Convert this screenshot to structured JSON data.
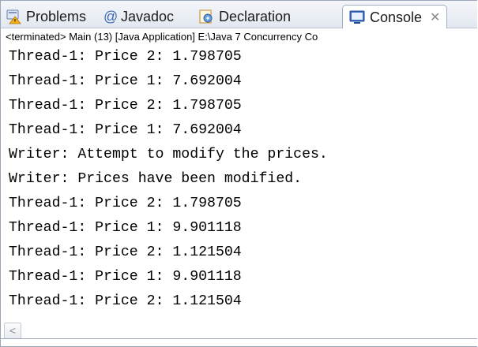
{
  "tabs": [
    {
      "label": "Problems",
      "icon": "problems-icon"
    },
    {
      "label": "Javadoc",
      "icon": "javadoc-icon"
    },
    {
      "label": "Declaration",
      "icon": "declaration-icon"
    },
    {
      "label": "Console",
      "icon": "console-icon",
      "active": true,
      "close": "✕"
    }
  ],
  "console": {
    "status": "<terminated> Main (13) [Java Application] E:\\Java 7 Concurrency Co",
    "lines": [
      "Thread-1: Price 2: 1.798705",
      "Thread-1: Price 1: 7.692004",
      "Thread-1: Price 2: 1.798705",
      "Thread-1: Price 1: 7.692004",
      "Writer: Attempt to modify the prices.",
      "Writer: Prices have been modified.",
      "Thread-1: Price 2: 1.798705",
      "Thread-1: Price 1: 9.901118",
      "Thread-1: Price 2: 1.121504",
      "Thread-1: Price 1: 9.901118",
      "Thread-1: Price 2: 1.121504"
    ]
  },
  "scrollbar": {
    "left_arrow": "<"
  }
}
